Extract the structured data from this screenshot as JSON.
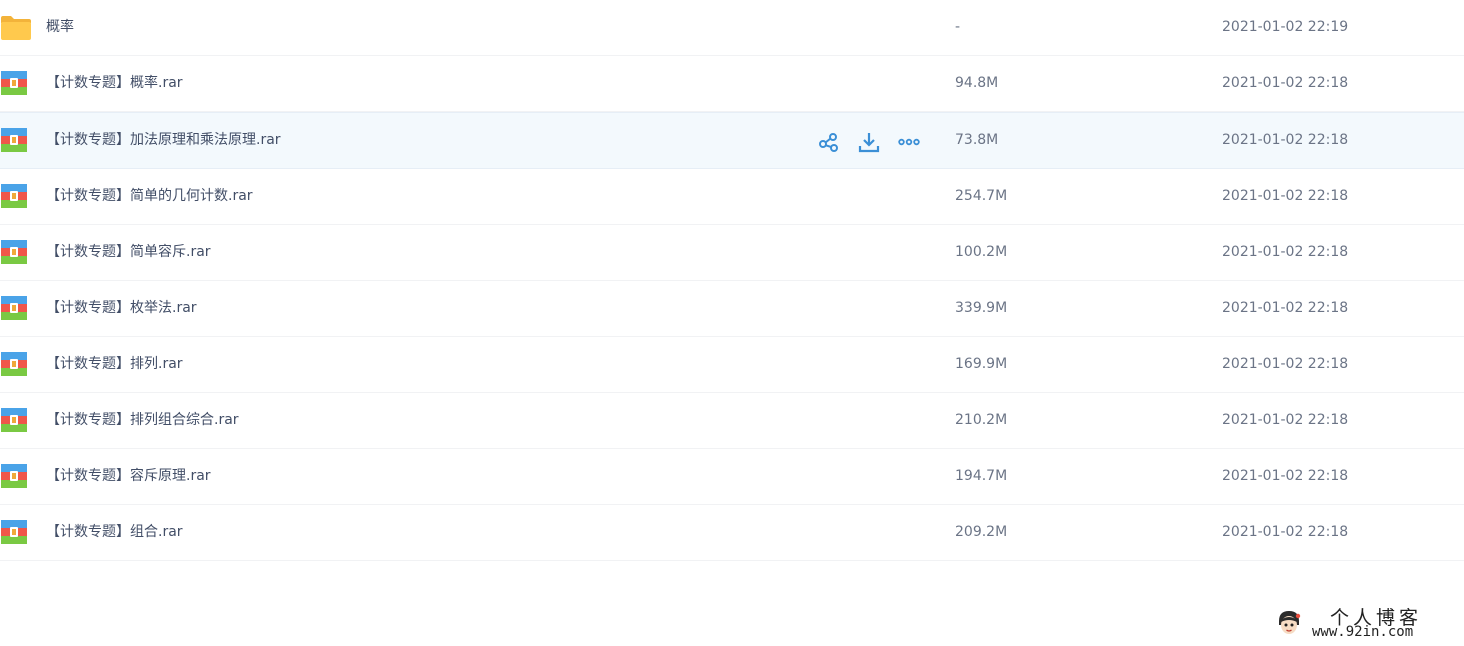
{
  "rows": [
    {
      "type": "folder",
      "icon": "folder-icon",
      "name": "概率",
      "size": "-",
      "time": "2021-01-02 22:19"
    },
    {
      "type": "archive",
      "icon": "rar-archive-icon",
      "name": "【计数专题】概率.rar",
      "size": "94.8M",
      "time": "2021-01-02 22:18"
    },
    {
      "type": "archive",
      "icon": "rar-archive-icon",
      "name": "【计数专题】加法原理和乘法原理.rar",
      "size": "73.8M",
      "time": "2021-01-02 22:18",
      "hovered": true
    },
    {
      "type": "archive",
      "icon": "rar-archive-icon",
      "name": "【计数专题】简单的几何计数.rar",
      "size": "254.7M",
      "time": "2021-01-02 22:18"
    },
    {
      "type": "archive",
      "icon": "rar-archive-icon",
      "name": "【计数专题】简单容斥.rar",
      "size": "100.2M",
      "time": "2021-01-02 22:18"
    },
    {
      "type": "archive",
      "icon": "rar-archive-icon",
      "name": "【计数专题】枚举法.rar",
      "size": "339.9M",
      "time": "2021-01-02 22:18"
    },
    {
      "type": "archive",
      "icon": "rar-archive-icon",
      "name": "【计数专题】排列.rar",
      "size": "169.9M",
      "time": "2021-01-02 22:18"
    },
    {
      "type": "archive",
      "icon": "rar-archive-icon",
      "name": "【计数专题】排列组合综合.rar",
      "size": "210.2M",
      "time": "2021-01-02 22:18"
    },
    {
      "type": "archive",
      "icon": "rar-archive-icon",
      "name": "【计数专题】容斥原理.rar",
      "size": "194.7M",
      "time": "2021-01-02 22:18"
    },
    {
      "type": "archive",
      "icon": "rar-archive-icon",
      "name": "【计数专题】组合.rar",
      "size": "209.2M",
      "time": "2021-01-02 22:18"
    }
  ],
  "row_actions": [
    "share-icon",
    "download-icon",
    "more-icon"
  ],
  "colors": {
    "accent": "#3b8fd6",
    "hover_row": "#f3f9fd",
    "folder": "#ffc94d"
  },
  "watermark": {
    "line1": "个人博客",
    "line2": "www.92in.com"
  }
}
